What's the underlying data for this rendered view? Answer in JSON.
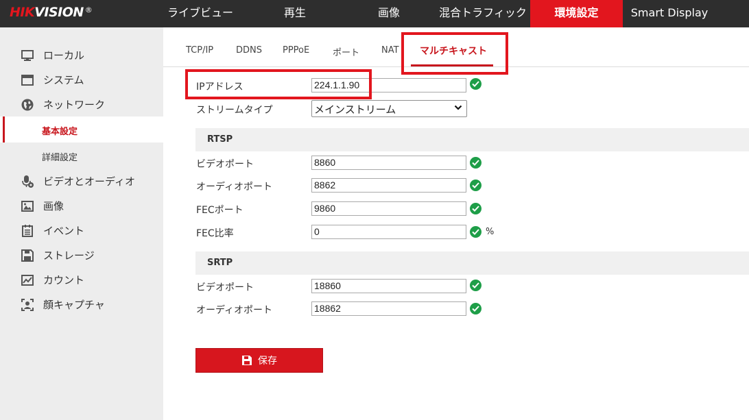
{
  "brand": {
    "part1": "HIK",
    "part2": "VISION",
    "reg": "®"
  },
  "top_nav": [
    {
      "label": "ライブビュー",
      "active": false
    },
    {
      "label": "再生",
      "active": false
    },
    {
      "label": "画像",
      "active": false
    },
    {
      "label": "混合トラフィック",
      "active": false
    },
    {
      "label": "環境設定",
      "active": true
    },
    {
      "label": "Smart Display",
      "active": false
    }
  ],
  "sidebar": {
    "items": [
      {
        "label": "ローカル",
        "icon": "monitor-icon"
      },
      {
        "label": "システム",
        "icon": "window-icon"
      },
      {
        "label": "ネットワーク",
        "icon": "globe-icon"
      },
      {
        "label": "基本設定",
        "sub": true,
        "active": true
      },
      {
        "label": "詳細設定",
        "sub": true,
        "active": false
      },
      {
        "label": "ビデオとオーディオ",
        "icon": "microphone-camera-icon"
      },
      {
        "label": "画像",
        "icon": "image-icon"
      },
      {
        "label": "イベント",
        "icon": "calendar-icon"
      },
      {
        "label": "ストレージ",
        "icon": "save-disk-icon"
      },
      {
        "label": "カウント",
        "icon": "chart-icon"
      },
      {
        "label": "顔キャプチャ",
        "icon": "face-capture-icon"
      }
    ]
  },
  "tabs": [
    {
      "label": "TCP/IP",
      "active": false
    },
    {
      "label": "DDNS",
      "active": false
    },
    {
      "label": "PPPoE",
      "active": false
    },
    {
      "label": "ポート",
      "active": false
    },
    {
      "label": "NAT",
      "active": false
    },
    {
      "label": "マルチキャスト",
      "active": true
    }
  ],
  "form": {
    "ip_address": {
      "label": "IPアドレス",
      "value": "224.1.1.90"
    },
    "stream_type": {
      "label": "ストリームタイプ",
      "value": "メインストリーム"
    },
    "rtsp": {
      "title": "RTSP",
      "video_port": {
        "label": "ビデオポート",
        "value": "8860"
      },
      "audio_port": {
        "label": "オーディオポート",
        "value": "8862"
      },
      "fec_port": {
        "label": "FECポート",
        "value": "9860"
      },
      "fec_ratio": {
        "label": "FEC比率",
        "value": "0",
        "unit": "%"
      }
    },
    "srtp": {
      "title": "SRTP",
      "video_port": {
        "label": "ビデオポート",
        "value": "18860"
      },
      "audio_port": {
        "label": "オーディオポート",
        "value": "18862"
      }
    }
  },
  "save_button": {
    "label": "保存",
    "icon": "save-disk-icon"
  },
  "colors": {
    "accent": "#e2161e",
    "topbar": "#2e2e2e",
    "sidebar": "#ededed",
    "valid": "#1e9e48"
  }
}
